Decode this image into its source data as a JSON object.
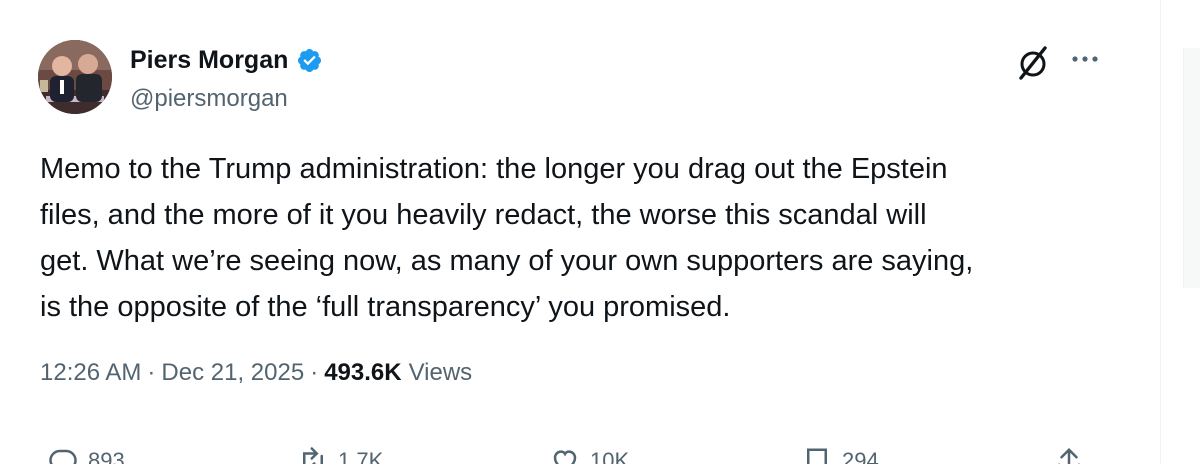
{
  "author": {
    "display_name": "Piers Morgan",
    "handle": "@piersmorgan",
    "verified": true
  },
  "tweet": {
    "text": "Memo to the Trump administration: the longer you drag out the Epstein\nfiles, and the more of it you heavily redact, the worse this scandal will\nget. What we’re seeing now, as many of your own supporters are saying,\nis the opposite of the ‘full transparency’ you promised.",
    "time": "12:26 AM",
    "date": "Dec 21, 2025",
    "views_count": "493.6K",
    "views_label": "Views",
    "separator": "·"
  },
  "actions": {
    "reply_count": "893",
    "repost_count": "1.7K",
    "like_count": "10K",
    "bookmark_count": "294"
  },
  "icons": {
    "verified": "verified-badge-icon",
    "grok": "grok-icon",
    "more": "more-options-icon",
    "reply": "reply-icon",
    "repost": "repost-icon",
    "like": "like-icon",
    "bookmark": "bookmark-icon",
    "share": "share-icon"
  },
  "colors": {
    "text_primary": "#0f1419",
    "text_secondary": "#536471",
    "verified": "#1d9bf0"
  }
}
